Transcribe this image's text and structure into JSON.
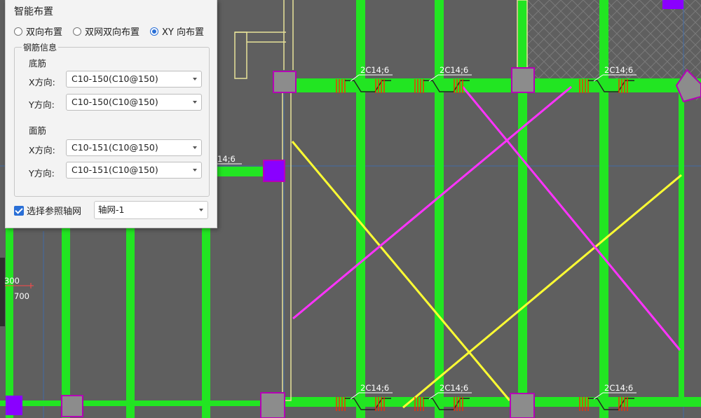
{
  "panel": {
    "title": "智能布置",
    "layout_options": [
      {
        "label": "双向布置",
        "selected": false
      },
      {
        "label": "双网双向布置",
        "selected": false
      },
      {
        "label": "XY 向布置",
        "selected": true
      }
    ],
    "rebar_info_label": "钢筋信息",
    "bottom_rebar": {
      "label": "底筋",
      "x_label": "X方向:",
      "x_value": "C10-150(C10@150)",
      "y_label": "Y方向:",
      "y_value": "C10-150(C10@150)"
    },
    "top_rebar": {
      "label": "面筋",
      "x_label": "X方向:",
      "x_value": "C10-151(C10@150)",
      "y_label": "Y方向:",
      "y_value": "C10-151(C10@150)"
    },
    "ref_grid_checkbox": {
      "label": "选择参照轴网",
      "checked": true
    },
    "ref_grid_select": "轴网-1"
  },
  "drawing": {
    "beam_labels": [
      "2C14;6",
      "2C14;6",
      "2C14;6",
      "2C14;6",
      "2C14;6",
      "2C14;6"
    ],
    "partial_label": "14;6",
    "dim_300": "300",
    "dim_700": "700",
    "colors": {
      "background": "#5f5f5f",
      "beam": "#22e522",
      "column": "#8c8c8c",
      "column_border": "#b500b5",
      "column_purple": "#8a00ff",
      "yellow_line": "#ffff33",
      "magenta_line": "#ff33ff",
      "rebar_red": "#ff2a00",
      "accent": "#2a6fd6"
    }
  }
}
